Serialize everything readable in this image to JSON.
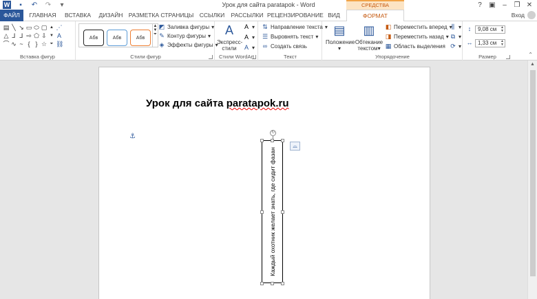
{
  "window": {
    "title": "Урок для сайта paratapok - Word",
    "context_banner": "СРЕДСТВА РИСОВАНИЯ"
  },
  "qat": {
    "icons": [
      "word-icon",
      "save-icon",
      "undo-icon",
      "redo-icon",
      "customize-icon"
    ]
  },
  "tabs": [
    "ФАЙЛ",
    "ГЛАВНАЯ",
    "ВСТАВКА",
    "ДИЗАЙН",
    "РАЗМЕТКА СТРАНИЦЫ",
    "ССЫЛКИ",
    "РАССЫЛКИ",
    "РЕЦЕНЗИРОВАНИЕ",
    "ВИД",
    "ФОРМАТ"
  ],
  "login": "Вход",
  "ribbon": {
    "groups": [
      "Вставка фигур",
      "Стили фигур",
      "Стили WordArt",
      "Текст",
      "Упорядочение",
      "Размер"
    ],
    "shape_style_sample": "Абв",
    "shape_style_cmds": [
      "Заливка фигуры",
      "Контур фигуры",
      "Эффекты фигуры"
    ],
    "wordart_express": [
      "Экспресс-",
      "стили"
    ],
    "text_cmds": [
      "Направление текста",
      "Выровнять текст",
      "Создать связь"
    ],
    "arrange_big": [
      [
        "Положение"
      ],
      [
        "Обтекание",
        "текстом"
      ]
    ],
    "arrange_cmds": [
      "Переместить вперед",
      "Переместить назад",
      "Область выделения"
    ],
    "size": {
      "height": "9,08 см",
      "width": "1,33 см"
    }
  },
  "document": {
    "title_part1": "Урок для сайта ",
    "title_part2": "paratapok.ru",
    "textbox_text": "Каждый охотник желает знать, где сидит фазан"
  }
}
